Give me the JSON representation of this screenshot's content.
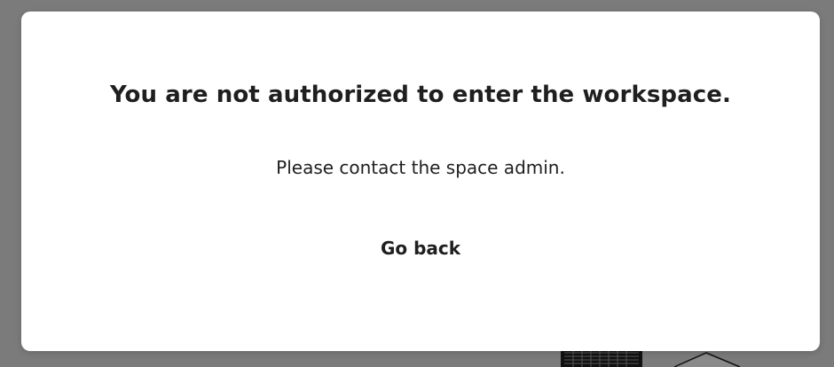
{
  "modal": {
    "title": "You are not authorized to enter the workspace.",
    "message": "Please contact the space admin.",
    "go_back_label": "Go back"
  },
  "colors": {
    "backdrop": "#7b7b7b",
    "modal_background": "#ffffff",
    "text": "#1f1f1f"
  }
}
